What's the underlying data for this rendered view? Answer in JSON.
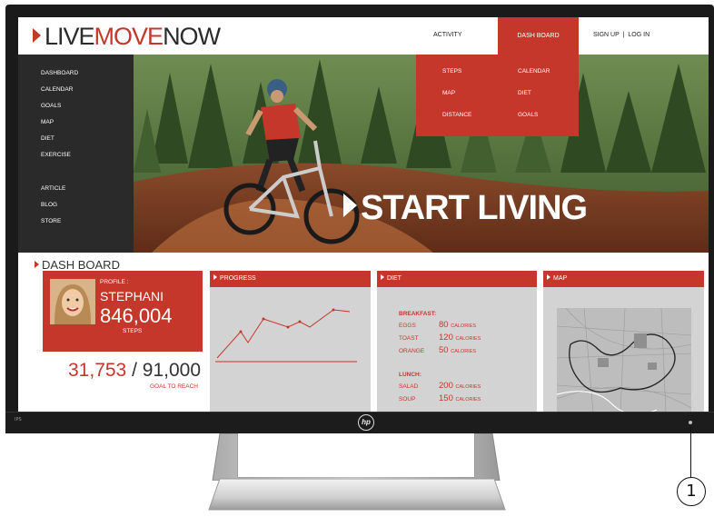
{
  "site": {
    "logo": {
      "part1": "LIVE",
      "part2": "MOVE",
      "part3": "NOW"
    },
    "nav": {
      "activity": "ACTIVITY",
      "dashboard": "DASH BOARD",
      "signup": "SIGN UP",
      "separator": "|",
      "login": "LOG IN"
    },
    "dropdown": {
      "col1": [
        "STEPS",
        "MAP",
        "DISTANCE"
      ],
      "col2": [
        "CALENDAR",
        "DIET",
        "GOALS"
      ]
    },
    "sidebar": {
      "items": [
        "DASHBOARD",
        "CALENDAR",
        "GOALS",
        "MAP",
        "DIET",
        "EXERCISE"
      ],
      "secondary": [
        "ARTICLE",
        "BLOG",
        "STORE"
      ]
    },
    "hero": {
      "headline": "START LIVING"
    }
  },
  "dashboard": {
    "title": "DASH BOARD",
    "profile": {
      "label": "PROFILE :",
      "name": "STEPHANI",
      "steps": "846,004",
      "steps_label": "STEPS"
    },
    "goal": {
      "current": "31,753",
      "separator": "/",
      "target": "91,000",
      "label": "GOAL TO REACH"
    },
    "panels": {
      "progress": {
        "title": "PROGRESS"
      },
      "diet": {
        "title": "DIET",
        "breakfast": {
          "heading": "BREAKFAST:",
          "items": [
            {
              "food": "EGGS",
              "amount": "80",
              "unit": "CALORIES"
            },
            {
              "food": "TOAST",
              "amount": "120",
              "unit": "CALORIES"
            },
            {
              "food": "ORANGE",
              "amount": "50",
              "unit": "CALORIES"
            }
          ]
        },
        "lunch": {
          "heading": "LUNCH:",
          "items": [
            {
              "food": "SALAD",
              "amount": "200",
              "unit": "CALORIES"
            },
            {
              "food": "SOUP",
              "amount": "150",
              "unit": "CALORIES"
            }
          ]
        }
      },
      "map": {
        "title": "MAP"
      }
    }
  },
  "monitor": {
    "model": "IPS",
    "brand": "hp",
    "callout": "1"
  },
  "colors": {
    "accent": "#c4372a",
    "sidebar": "#2a2a2a",
    "panel": "#d3d3d3",
    "bezel": "#1a1a1a"
  }
}
